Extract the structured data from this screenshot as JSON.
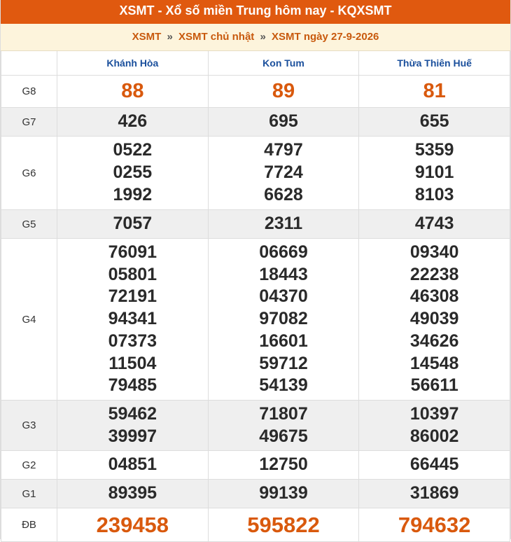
{
  "header": {
    "title": "XSMT - Xổ số miền Trung hôm nay - KQXSMT"
  },
  "breadcrumb": {
    "item1": "XSMT",
    "sep": "»",
    "item2": "XSMT chủ nhật",
    "item3": "XSMT ngày 27-9-2026"
  },
  "provinces": [
    "Khánh Hòa",
    "Kon Tum",
    "Thừa Thiên Huế"
  ],
  "prizes": {
    "g8": {
      "label": "G8",
      "values": [
        [
          "88"
        ],
        [
          "89"
        ],
        [
          "81"
        ]
      ]
    },
    "g7": {
      "label": "G7",
      "values": [
        [
          "426"
        ],
        [
          "695"
        ],
        [
          "655"
        ]
      ]
    },
    "g6": {
      "label": "G6",
      "values": [
        [
          "0522",
          "0255",
          "1992"
        ],
        [
          "4797",
          "7724",
          "6628"
        ],
        [
          "5359",
          "9101",
          "8103"
        ]
      ]
    },
    "g5": {
      "label": "G5",
      "values": [
        [
          "7057"
        ],
        [
          "2311"
        ],
        [
          "4743"
        ]
      ]
    },
    "g4": {
      "label": "G4",
      "values": [
        [
          "76091",
          "05801",
          "72191",
          "94341",
          "07373",
          "11504",
          "79485"
        ],
        [
          "06669",
          "18443",
          "04370",
          "97082",
          "16601",
          "59712",
          "54139"
        ],
        [
          "09340",
          "22238",
          "46308",
          "49039",
          "34626",
          "14548",
          "56611"
        ]
      ]
    },
    "g3": {
      "label": "G3",
      "values": [
        [
          "59462",
          "39997"
        ],
        [
          "71807",
          "49675"
        ],
        [
          "10397",
          "86002"
        ]
      ]
    },
    "g2": {
      "label": "G2",
      "values": [
        [
          "04851"
        ],
        [
          "12750"
        ],
        [
          "66445"
        ]
      ]
    },
    "g1": {
      "label": "G1",
      "values": [
        [
          "89395"
        ],
        [
          "99139"
        ],
        [
          "31869"
        ]
      ]
    },
    "db": {
      "label": "ĐB",
      "values": [
        [
          "239458"
        ],
        [
          "595822"
        ],
        [
          "794632"
        ]
      ]
    }
  },
  "colors": {
    "header_bg": "#e0590f",
    "accent": "#d9590d",
    "province": "#1a4f9c",
    "breadcrumb_bg": "#fdf4dc"
  }
}
